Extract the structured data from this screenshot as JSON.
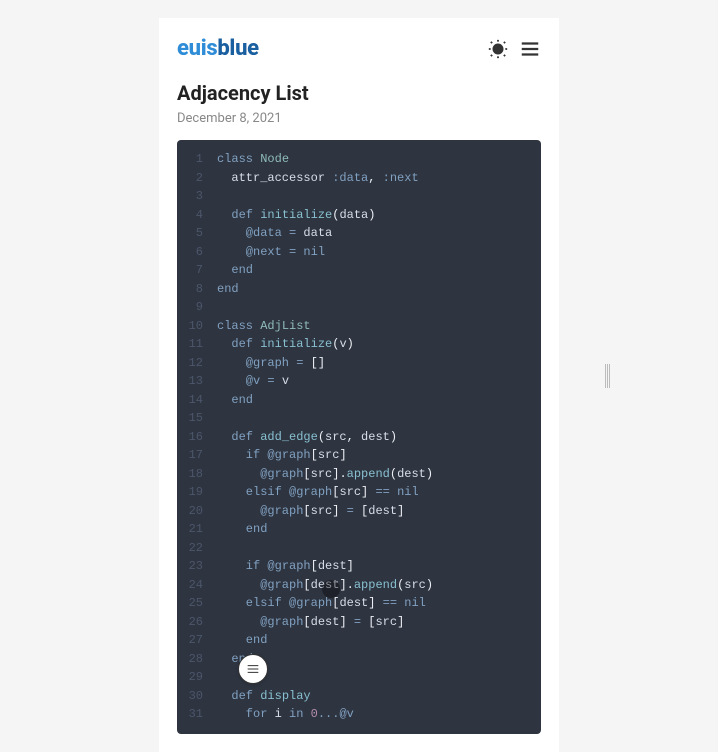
{
  "header": {
    "logo_a": "euis",
    "logo_b": "blue"
  },
  "post": {
    "title": "Adjacency List",
    "date": "December 8, 2021"
  },
  "code": {
    "lines": [
      {
        "n": 1,
        "t": [
          [
            "kw",
            "class "
          ],
          [
            "cls",
            "Node"
          ]
        ]
      },
      {
        "n": 2,
        "t": [
          [
            "var",
            "  attr_accessor "
          ],
          [
            "sym",
            ":data"
          ],
          [
            "punc",
            ", "
          ],
          [
            "sym",
            ":next"
          ]
        ]
      },
      {
        "n": 3,
        "t": []
      },
      {
        "n": 4,
        "t": [
          [
            "kw",
            "  def "
          ],
          [
            "fn",
            "initialize"
          ],
          [
            "punc",
            "("
          ],
          [
            "var",
            "data"
          ],
          [
            "punc",
            ")"
          ]
        ]
      },
      {
        "n": 5,
        "t": [
          [
            "ivar",
            "    @data"
          ],
          [
            "op",
            " = "
          ],
          [
            "var",
            "data"
          ]
        ]
      },
      {
        "n": 6,
        "t": [
          [
            "ivar",
            "    @next"
          ],
          [
            "op",
            " = "
          ],
          [
            "nil",
            "nil"
          ]
        ]
      },
      {
        "n": 7,
        "t": [
          [
            "kw",
            "  end"
          ]
        ]
      },
      {
        "n": 8,
        "t": [
          [
            "kw",
            "end"
          ]
        ]
      },
      {
        "n": 9,
        "t": []
      },
      {
        "n": 10,
        "t": [
          [
            "kw",
            "class "
          ],
          [
            "cls",
            "AdjList"
          ]
        ]
      },
      {
        "n": 11,
        "t": [
          [
            "kw",
            "  def "
          ],
          [
            "fn",
            "initialize"
          ],
          [
            "punc",
            "("
          ],
          [
            "var",
            "v"
          ],
          [
            "punc",
            ")"
          ]
        ]
      },
      {
        "n": 12,
        "t": [
          [
            "ivar",
            "    @graph"
          ],
          [
            "op",
            " = "
          ],
          [
            "punc",
            "[]"
          ]
        ]
      },
      {
        "n": 13,
        "t": [
          [
            "ivar",
            "    @v"
          ],
          [
            "op",
            " = "
          ],
          [
            "var",
            "v"
          ]
        ]
      },
      {
        "n": 14,
        "t": [
          [
            "kw",
            "  end"
          ]
        ]
      },
      {
        "n": 15,
        "t": []
      },
      {
        "n": 16,
        "t": [
          [
            "kw",
            "  def "
          ],
          [
            "fn",
            "add_edge"
          ],
          [
            "punc",
            "("
          ],
          [
            "var",
            "src"
          ],
          [
            "punc",
            ", "
          ],
          [
            "var",
            "dest"
          ],
          [
            "punc",
            ")"
          ]
        ]
      },
      {
        "n": 17,
        "t": [
          [
            "kw",
            "    if "
          ],
          [
            "ivar",
            "@graph"
          ],
          [
            "punc",
            "["
          ],
          [
            "var",
            "src"
          ],
          [
            "punc",
            "]"
          ]
        ]
      },
      {
        "n": 18,
        "t": [
          [
            "ivar",
            "      @graph"
          ],
          [
            "punc",
            "["
          ],
          [
            "var",
            "src"
          ],
          [
            "punc",
            "]"
          ],
          [
            "punc",
            "."
          ],
          [
            "fn",
            "append"
          ],
          [
            "punc",
            "("
          ],
          [
            "var",
            "dest"
          ],
          [
            "punc",
            ")"
          ]
        ]
      },
      {
        "n": 19,
        "t": [
          [
            "kw",
            "    elsif "
          ],
          [
            "ivar",
            "@graph"
          ],
          [
            "punc",
            "["
          ],
          [
            "var",
            "src"
          ],
          [
            "punc",
            "]"
          ],
          [
            "op",
            " == "
          ],
          [
            "nil",
            "nil"
          ]
        ]
      },
      {
        "n": 20,
        "t": [
          [
            "ivar",
            "      @graph"
          ],
          [
            "punc",
            "["
          ],
          [
            "var",
            "src"
          ],
          [
            "punc",
            "]"
          ],
          [
            "op",
            " = "
          ],
          [
            "punc",
            "["
          ],
          [
            "var",
            "dest"
          ],
          [
            "punc",
            "]"
          ]
        ]
      },
      {
        "n": 21,
        "t": [
          [
            "kw",
            "    end"
          ]
        ]
      },
      {
        "n": 22,
        "t": []
      },
      {
        "n": 23,
        "t": [
          [
            "kw",
            "    if "
          ],
          [
            "ivar",
            "@graph"
          ],
          [
            "punc",
            "["
          ],
          [
            "var",
            "dest"
          ],
          [
            "punc",
            "]"
          ]
        ]
      },
      {
        "n": 24,
        "t": [
          [
            "ivar",
            "      @graph"
          ],
          [
            "punc",
            "["
          ],
          [
            "var",
            "dest"
          ],
          [
            "punc",
            "]"
          ],
          [
            "punc",
            "."
          ],
          [
            "fn",
            "append"
          ],
          [
            "punc",
            "("
          ],
          [
            "var",
            "src"
          ],
          [
            "punc",
            ")"
          ]
        ]
      },
      {
        "n": 25,
        "t": [
          [
            "kw",
            "    elsif "
          ],
          [
            "ivar",
            "@graph"
          ],
          [
            "punc",
            "["
          ],
          [
            "var",
            "dest"
          ],
          [
            "punc",
            "]"
          ],
          [
            "op",
            " == "
          ],
          [
            "nil",
            "nil"
          ]
        ]
      },
      {
        "n": 26,
        "t": [
          [
            "ivar",
            "      @graph"
          ],
          [
            "punc",
            "["
          ],
          [
            "var",
            "dest"
          ],
          [
            "punc",
            "]"
          ],
          [
            "op",
            " = "
          ],
          [
            "punc",
            "["
          ],
          [
            "var",
            "src"
          ],
          [
            "punc",
            "]"
          ]
        ]
      },
      {
        "n": 27,
        "t": [
          [
            "kw",
            "    end"
          ]
        ]
      },
      {
        "n": 28,
        "t": [
          [
            "kw",
            "  end"
          ]
        ]
      },
      {
        "n": 29,
        "t": []
      },
      {
        "n": 30,
        "t": [
          [
            "kw",
            "  def "
          ],
          [
            "fn",
            "display"
          ]
        ]
      },
      {
        "n": 31,
        "t": [
          [
            "kw",
            "    for "
          ],
          [
            "var",
            "i"
          ],
          [
            "kw",
            " in "
          ],
          [
            "num",
            "0"
          ],
          [
            "op",
            "..."
          ],
          [
            "ivar",
            "@v"
          ]
        ]
      }
    ]
  }
}
